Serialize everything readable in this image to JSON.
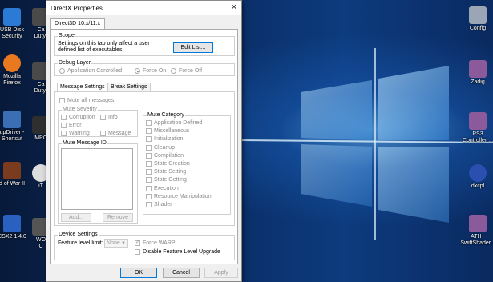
{
  "desktop": {
    "left_icons": [
      {
        "label": "USB Disk\nSecurity",
        "icon": "usb-disk-icon",
        "color": "#2b7bd6"
      },
      {
        "label": "Mozilla\nFirefox",
        "icon": "firefox-icon",
        "color": "#e8791e"
      },
      {
        "label": "upDriver -\nShortcut",
        "icon": "driver-icon",
        "color": "#3a6fb5"
      },
      {
        "label": "d of War II",
        "icon": "game-icon",
        "color": "#7a3b1e"
      },
      {
        "label": "CSX2 1.4.0",
        "icon": "pcsx2-icon",
        "color": "#2a60c0"
      }
    ],
    "mid_icons": [
      {
        "label": "Ca\nDuty(",
        "icon": "call-of-duty-icon",
        "color": "#4a4a4a"
      },
      {
        "label": "Ca\nDuty(",
        "icon": "call-of-duty-icon",
        "color": "#4a4a4a"
      },
      {
        "label": "MPC",
        "icon": "mpc-icon",
        "color": "#2f2f2f"
      },
      {
        "label": "iT",
        "icon": "itunes-icon",
        "color": "#dddddd"
      },
      {
        "label": "WO\nC",
        "icon": "game-icon",
        "color": "#555555"
      }
    ],
    "right_icons": [
      {
        "label": "Config",
        "icon": "config-icon",
        "color": "#9aa6b5"
      },
      {
        "label": "Zadig",
        "icon": "zadig-icon",
        "color": "#8a5a9a"
      },
      {
        "label": "PS3\nController ...",
        "icon": "archive-icon",
        "color": "#8a5a9a"
      },
      {
        "label": "dxcpl",
        "icon": "dxcpl-icon",
        "color": "#2a4fb0"
      },
      {
        "label": "ATH -\nSwiftShader...",
        "icon": "archive-icon",
        "color": "#8a5a9a"
      }
    ]
  },
  "dialog": {
    "title": "DirectX Properties",
    "close_glyph": "✕",
    "tab": "Direct3D 10.x/11.x",
    "scope": {
      "label": "Scope",
      "text": "Settings on this tab only affect a user\ndefined list of executables.",
      "edit_button": "Edit List..."
    },
    "debug_layer": {
      "label": "Debug Layer",
      "options": [
        "Application Controlled",
        "Force On",
        "Force Off"
      ],
      "selected": "Force On"
    },
    "subtabs": [
      "Message Settings",
      "Break Settings"
    ],
    "mute_all": "Mute all messages",
    "mute_severity": {
      "label": "Mute Severity",
      "items": [
        "Corruption",
        "Info",
        "Error",
        "Warning",
        "Message"
      ]
    },
    "mute_message_id": {
      "label": "Mute Message ID",
      "add": "Add...",
      "remove": "Remove"
    },
    "mute_category": {
      "label": "Mute Category",
      "items": [
        "Application Defined",
        "Miscellaneous",
        "Initialization",
        "Cleanup",
        "Compilation",
        "State Creation",
        "State Setting",
        "State Getting",
        "Execution",
        "Resource Manipulation",
        "Shader"
      ]
    },
    "device_settings": {
      "label": "Device Settings",
      "feature_level_label": "Feature level limit:",
      "feature_level_value": "None",
      "force_warp": "Force WARP",
      "disable_upgrade": "Disable Feature Level Upgrade"
    },
    "buttons": {
      "ok": "OK",
      "cancel": "Cancel",
      "apply": "Apply"
    }
  }
}
